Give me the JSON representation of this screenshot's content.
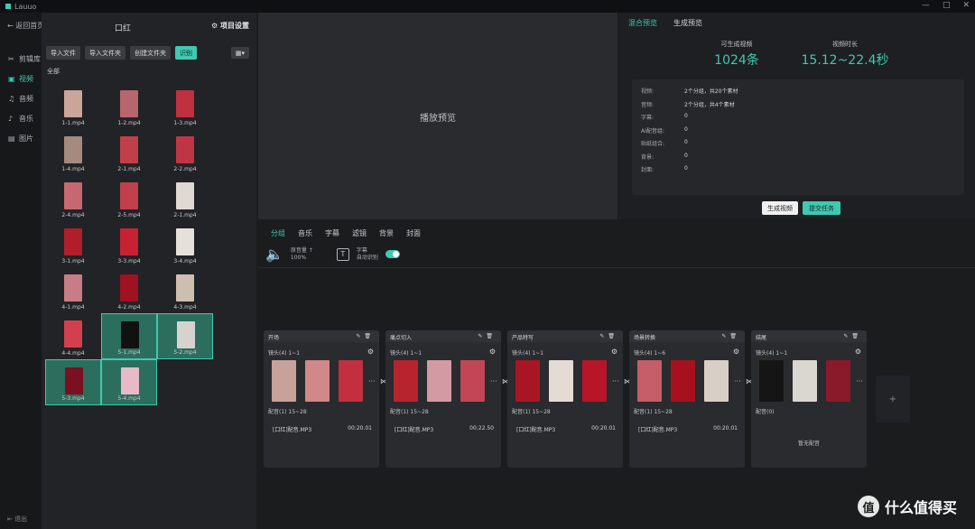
{
  "titlebar": {
    "name": "Lauuo",
    "controls": [
      "—",
      "□",
      "✕"
    ]
  },
  "nav": {
    "back": "← 返回首页",
    "items": [
      {
        "label": "剪辑库",
        "icon": "scissors-icon",
        "glyph": "✂"
      },
      {
        "label": "视频",
        "icon": "video-icon",
        "glyph": "▣",
        "active": true
      },
      {
        "label": "音频",
        "icon": "audio-icon",
        "glyph": "♫"
      },
      {
        "label": "音乐",
        "icon": "music-icon",
        "glyph": "♪"
      },
      {
        "label": "图片",
        "icon": "image-icon",
        "glyph": "▤"
      }
    ],
    "logout": "⇤ 退出"
  },
  "media": {
    "title": "口红",
    "settings": "⚙ 项目设置",
    "buttons": [
      "导入文件",
      "导入文件夹",
      "创建文件夹",
      "识别"
    ],
    "view_toggle": "▦▾",
    "group": "全部",
    "files": [
      {
        "name": "1-1.mp4",
        "color": "#c9a59a"
      },
      {
        "name": "1-2.mp4",
        "color": "#b8656d"
      },
      {
        "name": "1-3.mp4",
        "color": "#c0303e"
      },
      {
        "name": "1-4.mp4",
        "color": "#a58a80"
      },
      {
        "name": "2-1.mp4",
        "color": "#c0404a"
      },
      {
        "name": "2-2.mp4",
        "color": "#c03545"
      },
      {
        "name": "2-4.mp4",
        "color": "#c66872"
      },
      {
        "name": "2-5.mp4",
        "color": "#c2404b"
      },
      {
        "name": "2-1.mp4",
        "color": "#e0d8d2"
      },
      {
        "name": "3-1.mp4",
        "color": "#b01e2c"
      },
      {
        "name": "3-3.mp4",
        "color": "#c82232"
      },
      {
        "name": "3-4.mp4",
        "color": "#e6e0da"
      },
      {
        "name": "4-1.mp4",
        "color": "#c77d85"
      },
      {
        "name": "4-2.mp4",
        "color": "#9e1222"
      },
      {
        "name": "4-3.mp4",
        "color": "#cdbfb0"
      },
      {
        "name": "4-4.mp4",
        "color": "#d2404d"
      },
      {
        "name": "5-1.mp4",
        "color": "#111111",
        "selected": true
      },
      {
        "name": "5-2.mp4",
        "color": "#d6d3cf",
        "selected": true
      },
      {
        "name": "5-3.mp4",
        "color": "#7a1020",
        "selected": true
      },
      {
        "name": "5-4.mp4",
        "color": "#e8b9c6",
        "selected": true
      }
    ]
  },
  "preview": {
    "placeholder": "播放预览"
  },
  "stats": {
    "tabs": [
      "混合预览",
      "生成预览"
    ],
    "kpis": [
      {
        "label": "可生成视频",
        "value": "1024条"
      },
      {
        "label": "视频时长",
        "value": "15.12~22.4秒"
      }
    ],
    "rows": [
      {
        "k": "视频:",
        "v": "2个分组，共20个素材"
      },
      {
        "k": "音频:",
        "v": "2个分组，共4个素材"
      },
      {
        "k": "字幕:",
        "v": "0"
      },
      {
        "k": "AI配音组:",
        "v": "0"
      },
      {
        "k": "贴纸组合:",
        "v": "0"
      },
      {
        "k": "背景:",
        "v": "0"
      },
      {
        "k": "封面:",
        "v": "0"
      }
    ],
    "btn_white": "生成视频",
    "btn_accent": "提交任务"
  },
  "editor": {
    "tabs": [
      "分组",
      "音乐",
      "字幕",
      "滤镜",
      "背景",
      "封面"
    ],
    "volume_label": "原音量 ↑",
    "volume_value": "100%",
    "subtitle_label": "字幕",
    "subtitle_sub": "自动识别",
    "cards": [
      {
        "title": "开场",
        "sub": "镜头(4) 1~1",
        "thumbs": [
          "#c6a29a",
          "#d08888",
          "#c23040"
        ],
        "sub2": "配音(1) 15~28",
        "audio": "[口红]配音.MP3",
        "dur": "00:20.01"
      },
      {
        "title": "痛点切入",
        "sub": "镜头(4) 1~1",
        "thumbs": [
          "#b8242e",
          "#d49aa4",
          "#c24656"
        ],
        "sub2": "配音(1) 15~28",
        "audio": "[口红]配音.MP3",
        "dur": "00:22.50"
      },
      {
        "title": "产品特写",
        "sub": "镜头(4) 1~1",
        "thumbs": [
          "#a81624",
          "#e4dcd4",
          "#b81628"
        ],
        "sub2": "配音(1) 15~28",
        "audio": "[口红]配音.MP3",
        "dur": "00:20.01"
      },
      {
        "title": "场景转换",
        "sub": "镜头(4) 1~6",
        "thumbs": [
          "#c65e6a",
          "#a81020",
          "#d8cfc6"
        ],
        "sub2": "配音(1) 15~28",
        "audio": "[口红]配音.MP3",
        "dur": "00:20.01"
      },
      {
        "title": "结尾",
        "sub": "镜头(4) 1~1",
        "thumbs": [
          "#151515",
          "#dad6d0",
          "#8a1a2a"
        ],
        "sub2": "配音(0)",
        "audio": "",
        "dur": "",
        "empty": "暂无配音"
      }
    ],
    "add": "+"
  },
  "watermark": {
    "logo": "值",
    "text": "什么值得买"
  }
}
